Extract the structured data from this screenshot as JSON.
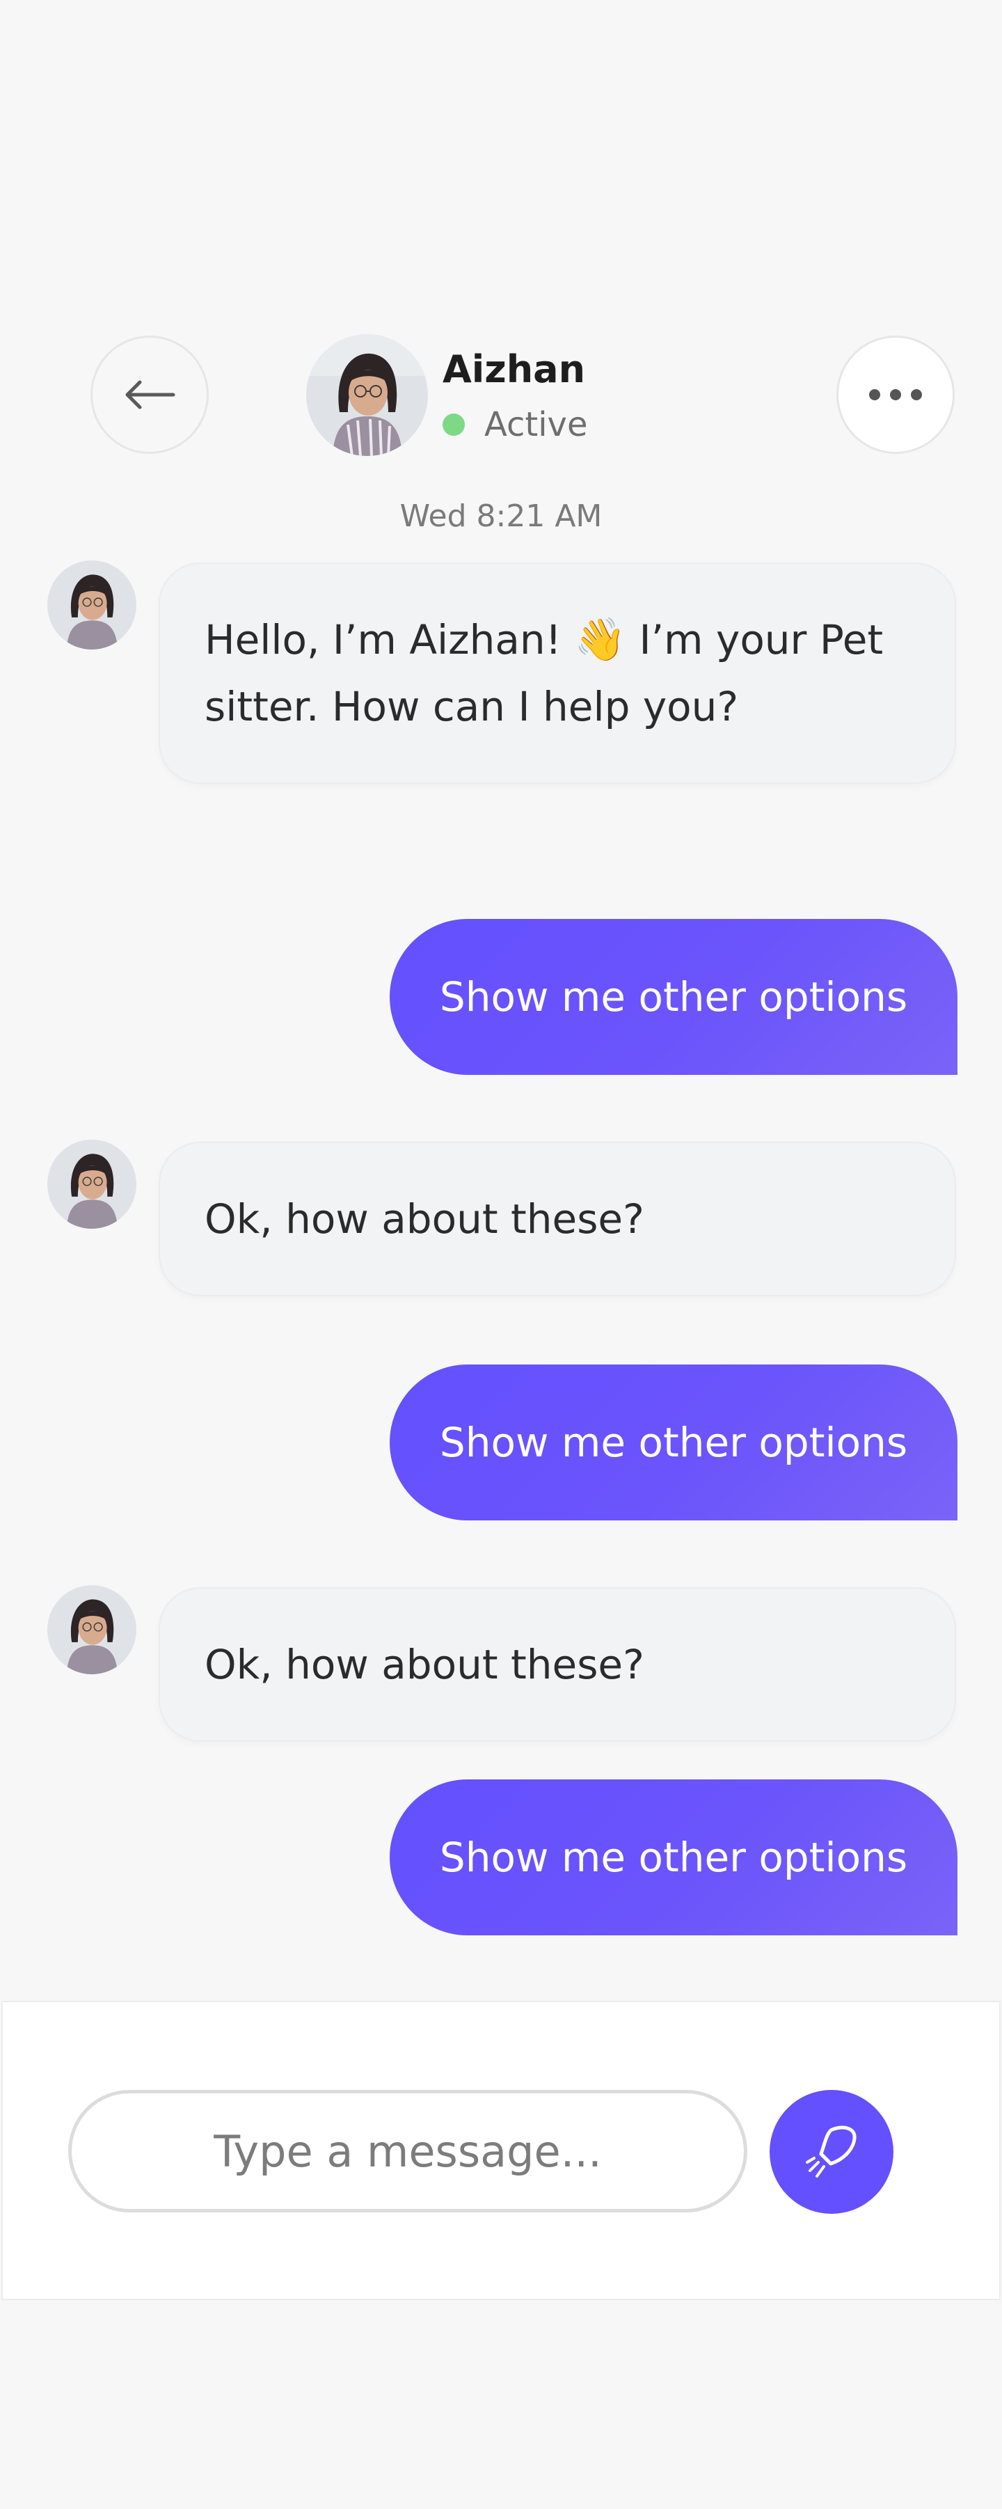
{
  "header": {
    "contact_name": "Aizhan",
    "status": "Active",
    "status_color": "#7ed987",
    "back_icon": "arrow-left-icon",
    "more_icon": "more-horizontal-icon"
  },
  "timestamp": "Wed 8:21 AM",
  "messages": [
    {
      "sender": "Aizhan",
      "text_before": "Hello, I’m Aizhan! ",
      "emoji": "👋",
      "text_after": " I’m your Pet sitter. How can I help you?"
    },
    {
      "sender": "me",
      "text": "Show me other options"
    },
    {
      "sender": "Aizhan",
      "text": "Ok, how about these?"
    },
    {
      "sender": "me",
      "text": "Show me other options"
    },
    {
      "sender": "Aizhan",
      "text": "Ok, how about these?"
    },
    {
      "sender": "me",
      "text": "Show me other options"
    }
  ],
  "composer": {
    "placeholder": "Type a message...",
    "value": "",
    "send_icon": "send-paper-plane-icon"
  },
  "colors": {
    "accent": "#6450ff",
    "incoming_bubble": "#f2f3f5",
    "background": "#f7f7f7"
  }
}
